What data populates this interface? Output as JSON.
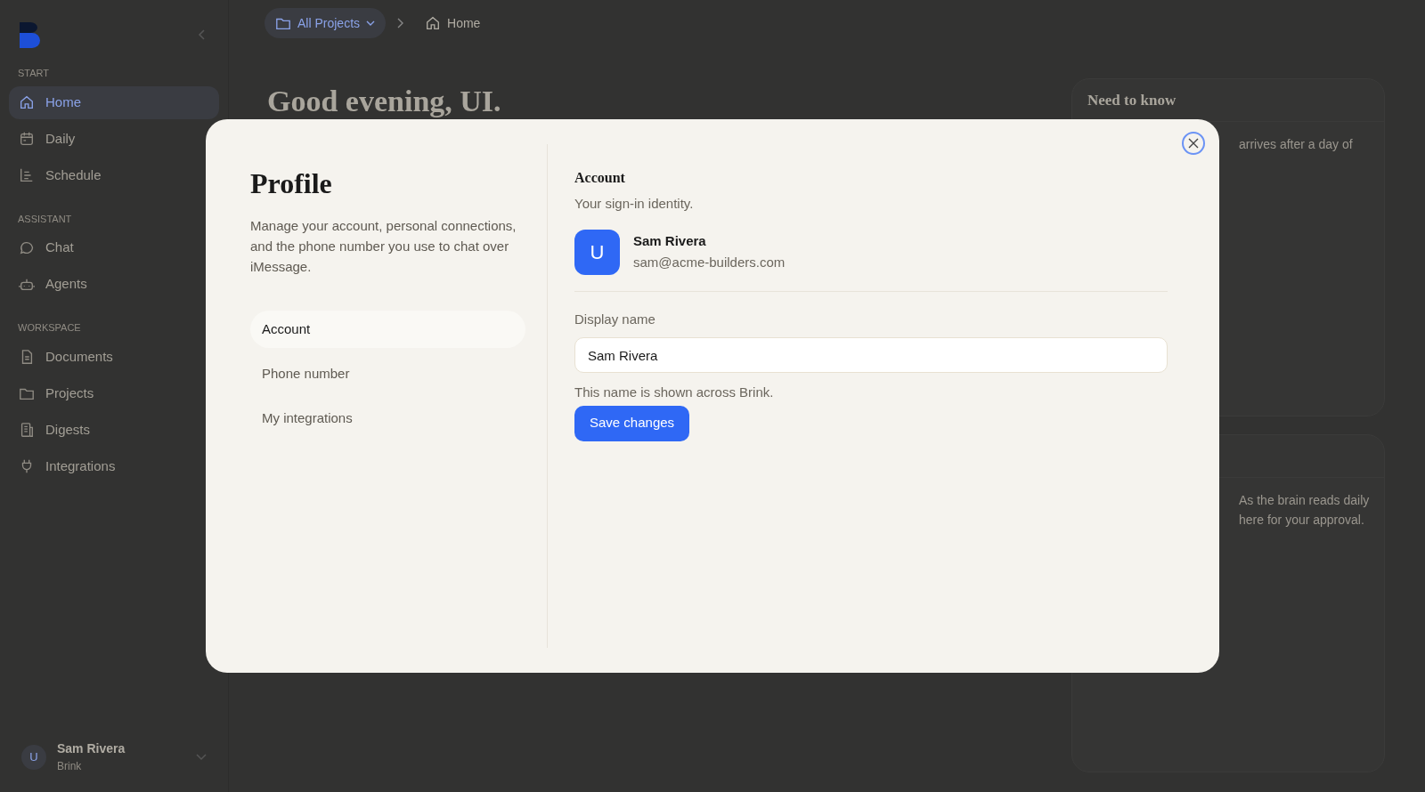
{
  "breadcrumb": [
    {
      "label": "All Projects",
      "kind": "dropdown"
    },
    {
      "label": "Home",
      "kind": "page"
    }
  ],
  "greeting": "Good evening, UI.",
  "sidebar": {
    "sections": [
      {
        "label": "START",
        "items": [
          {
            "label": "Home",
            "selected": true
          },
          {
            "label": "Daily",
            "selected": false
          },
          {
            "label": "Schedule",
            "selected": false
          }
        ]
      },
      {
        "label": "ASSISTANT",
        "items": [
          {
            "label": "Chat",
            "selected": false
          },
          {
            "label": "Agents",
            "selected": false
          }
        ]
      },
      {
        "label": "WORKSPACE",
        "items": [
          {
            "label": "Documents",
            "selected": false
          },
          {
            "label": "Projects",
            "selected": false
          },
          {
            "label": "Digests",
            "selected": false
          },
          {
            "label": "Integrations",
            "selected": false
          }
        ]
      }
    ],
    "user": {
      "initial": "U",
      "name": "Sam Rivera",
      "workspace": "Brink"
    }
  },
  "cards": [
    {
      "title": "Need to know",
      "lines": [
        "arrives after a day of"
      ]
    },
    {
      "lines": [
        "As the brain reads daily",
        "here for your approval."
      ]
    }
  ],
  "modal": {
    "title": "Profile",
    "description": "Manage your account, personal connections, and the phone number you use to chat over iMessage.",
    "nav": [
      {
        "label": "Account",
        "selected": true
      },
      {
        "label": "Phone number",
        "selected": false
      },
      {
        "label": "My integrations",
        "selected": false
      }
    ],
    "section_title": "Account",
    "section_subtitle": "Your sign-in identity.",
    "account": {
      "initial": "U",
      "name": "Sam Rivera",
      "email": "sam@acme-builders.com"
    },
    "field": {
      "label": "Display name",
      "value": "Sam Rivera",
      "hint": "This name is shown across Brink."
    },
    "button": "Save changes"
  }
}
